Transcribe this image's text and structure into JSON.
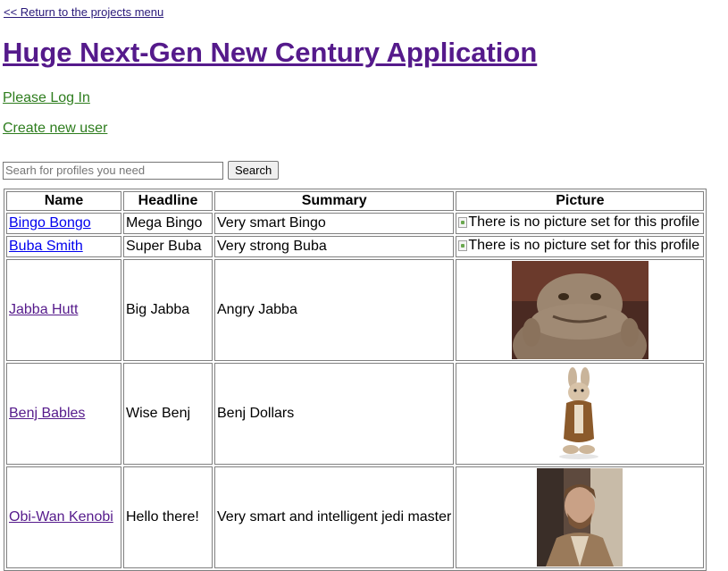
{
  "nav": {
    "back_label": "<< Return to the projects menu"
  },
  "header": {
    "title": "Huge Next-Gen New Century Application"
  },
  "auth": {
    "login_label": "Please Log In",
    "create_user_label": "Create new user"
  },
  "search": {
    "placeholder": "Searh for profiles you need",
    "value": "",
    "button_label": "Search"
  },
  "table": {
    "columns": [
      "Name",
      "Headline",
      "Summary",
      "Picture"
    ],
    "rows": [
      {
        "name": "Bingo Bongo",
        "headline": "Mega Bingo",
        "summary": "Very smart Bingo",
        "picture_alt": "There is no picture set for this profile"
      },
      {
        "name": "Buba Smith",
        "headline": "Super Buba",
        "summary": "Very strong Buba",
        "picture_alt": "There is no picture set for this profile"
      },
      {
        "name": "Jabba Hutt",
        "headline": "Big Jabba",
        "summary": "Angry Jabba",
        "picture_alt": ""
      },
      {
        "name": "Benj Bables",
        "headline": "Wise Benj",
        "summary": "Benj Dollars",
        "picture_alt": ""
      },
      {
        "name": "Obi-Wan Kenobi",
        "headline": "Hello there!",
        "summary": "Very smart and intelligent jedi master",
        "picture_alt": ""
      }
    ]
  },
  "colors": {
    "visited_link": "#551a8b",
    "unvisited_link": "#0000ee",
    "auth_link": "#2e7d1e"
  }
}
